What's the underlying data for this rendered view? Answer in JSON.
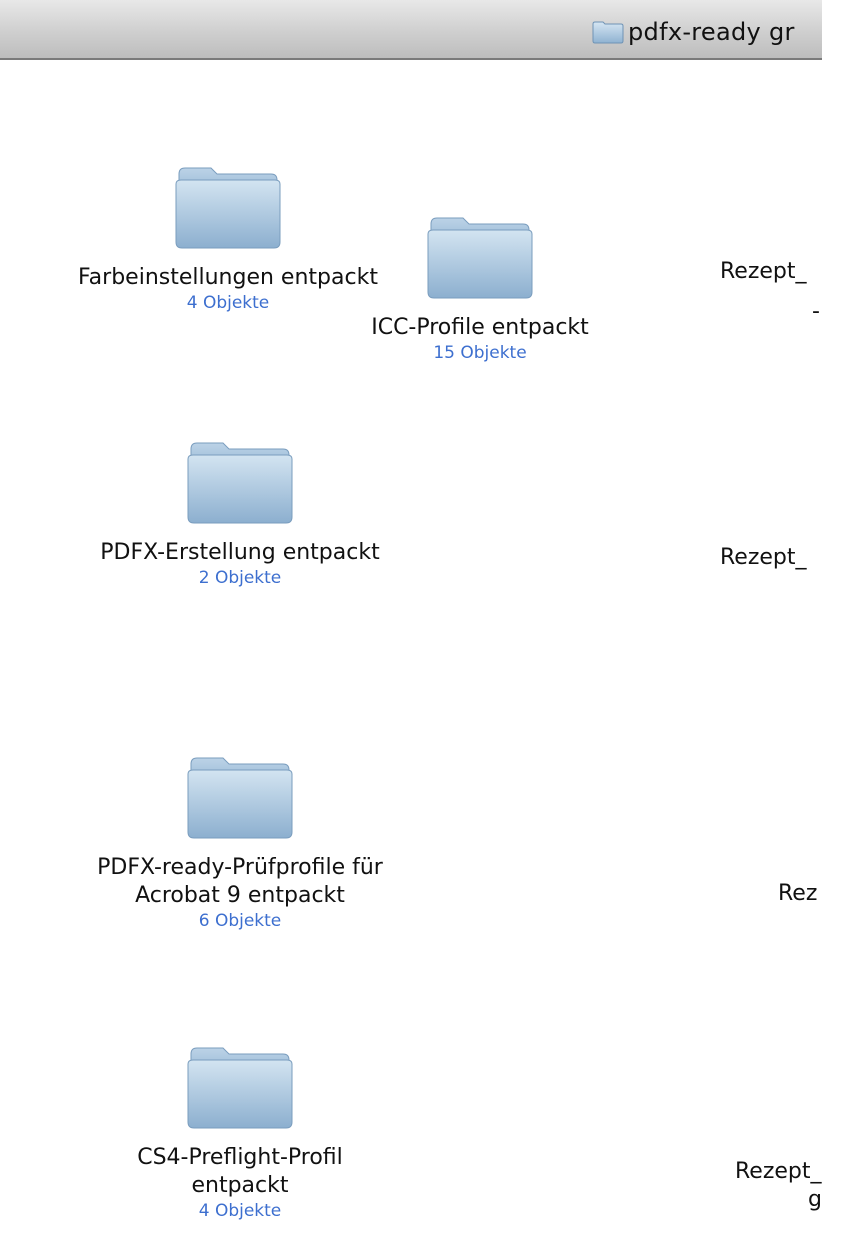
{
  "window": {
    "title": "pdfx-ready gr"
  },
  "folders": [
    {
      "name": "Farbeinstellungen entpackt",
      "count": "4 Objekte"
    },
    {
      "name": "ICC-Profile entpackt",
      "count": "15 Objekte"
    },
    {
      "name": "PDFX-Erstellung entpackt",
      "count": "2 Objekte"
    },
    {
      "name_line1": "PDFX-ready-Prüfprofile für",
      "name_line2": "Acrobat 9 entpackt",
      "count": "6 Objekte"
    },
    {
      "name_line1": "CS4-Preflight-Profil",
      "name_line2": "entpackt",
      "count": "4 Objekte"
    }
  ],
  "partial_items": [
    {
      "line1": "Rezept_",
      "line2": "-"
    },
    {
      "line1": "Rezept_"
    },
    {
      "line1": "Rez"
    },
    {
      "line1": "Rezept_",
      "line2": "g"
    }
  ],
  "icons": {
    "folder": "folder-icon"
  },
  "colors": {
    "folder_top": "#cfe0ee",
    "folder_bottom": "#8fb2d1",
    "count_text": "#3d6fcf"
  }
}
